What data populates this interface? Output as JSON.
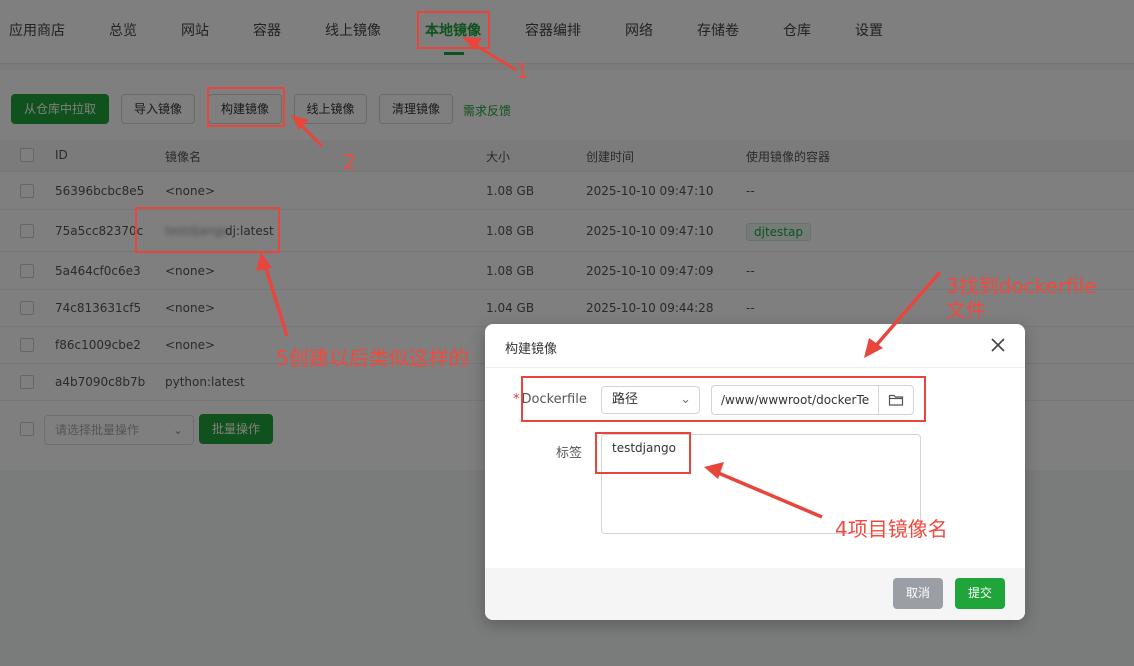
{
  "nav": {
    "tabs": [
      "应用商店",
      "总览",
      "网站",
      "容器",
      "线上镜像",
      "本地镜像",
      "容器编排",
      "网络",
      "存储卷",
      "仓库",
      "设置"
    ],
    "active": "本地镜像"
  },
  "toolbar": {
    "pull": "从仓库中拉取",
    "import": "导入镜像",
    "build": "构建镜像",
    "online": "线上镜像",
    "clean": "清理镜像",
    "feedback": "需求反馈"
  },
  "table": {
    "columns": [
      "ID",
      "镜像名",
      "大小",
      "创建时间",
      "使用镜像的容器"
    ],
    "rows": [
      {
        "id": "56396bcbc8e5",
        "name": "<none>",
        "size": "1.08 GB",
        "created": "2025-10-10 09:47:10",
        "containers": "--"
      },
      {
        "id": "75a5cc82370c",
        "name_blur": "testdjango",
        "name": "dj:latest",
        "size": "1.08 GB",
        "created": "2025-10-10 09:47:10",
        "containers": "djtestap"
      },
      {
        "id": "5a464cf0c6e3",
        "name": "<none>",
        "size": "1.08 GB",
        "created": "2025-10-10 09:47:09",
        "containers": "--"
      },
      {
        "id": "74c813631cf5",
        "name": "<none>",
        "size": "1.04 GB",
        "created": "2025-10-10 09:44:28",
        "containers": "--"
      },
      {
        "id": "f86c1009cbe2",
        "name": "<none>",
        "size": "",
        "created": "",
        "containers": ""
      },
      {
        "id": "a4b7090c8b7b",
        "name": "python:latest",
        "size": "",
        "created": "",
        "containers": ""
      }
    ]
  },
  "bulk": {
    "placeholder": "请选择批量操作",
    "button": "批量操作"
  },
  "modal": {
    "title": "构建镜像",
    "dockerfile_label": "Dockerfile",
    "mode": "路径",
    "path": "/www/wwwroot/dockerTe",
    "tag_label": "标签",
    "tag_value": "testdjango",
    "cancel": "取消",
    "submit": "提交"
  },
  "annotations": {
    "n1": "1",
    "n2": "2",
    "n3": "3找到dockerfile\n文件",
    "n4": "4项目镜像名",
    "n5": "5创建以后类似这样的"
  },
  "colors": {
    "accent": "#20a53a",
    "annotation": "#e8463d"
  },
  "icons": {
    "close": "close-icon",
    "folder": "folder-icon",
    "chevron": "chevron-down-icon"
  }
}
